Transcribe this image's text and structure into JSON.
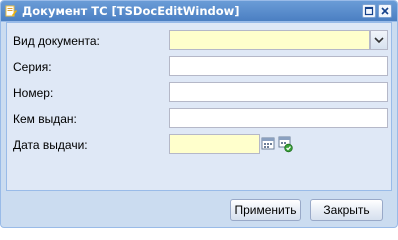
{
  "window": {
    "title": "Документ ТС [TSDocEditWindow]"
  },
  "form": {
    "doc_type": {
      "label": "Вид документа:",
      "value": ""
    },
    "series": {
      "label": "Серия:",
      "value": ""
    },
    "number": {
      "label": "Номер:",
      "value": ""
    },
    "issued_by": {
      "label": "Кем выдан:",
      "value": ""
    },
    "issue_date": {
      "label": "Дата выдачи:",
      "value": ""
    }
  },
  "buttons": {
    "apply": "Применить",
    "close": "Закрыть"
  },
  "icons": {
    "title": "document-edit-icon",
    "maximize": "maximize-icon",
    "close": "close-icon",
    "combo": "chevron-down-icon",
    "calendar": "calendar-icon",
    "today": "calendar-today-icon"
  },
  "colors": {
    "title_bar": "#4b7fc2",
    "window_frame": "#cbdcf0",
    "body": "#dfe8f6",
    "required_field": "#ffffcc"
  }
}
